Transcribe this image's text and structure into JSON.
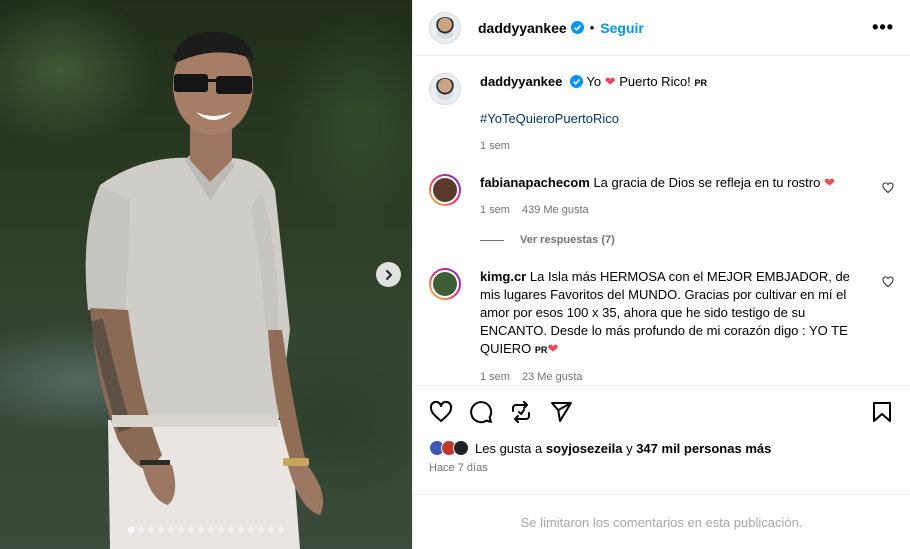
{
  "post": {
    "author": "daddyyankee",
    "follow_label": "Seguir",
    "separator": "•",
    "more_label": "•••",
    "caption_prefix": "Yo",
    "caption_suffix": "Puerto Rico!",
    "caption_badge": "PR",
    "hashtag": "#YoTeQuieroPuertoRico",
    "time": "1 sem"
  },
  "comments": [
    {
      "user": "fabianapachecom",
      "text": "La gracia de Dios se refleja en tu rostro",
      "time": "1 sem",
      "likes": "439 Me gusta",
      "view_replies": "Ver respuestas (7)"
    },
    {
      "user": "kimg.cr",
      "text": "La Isla más HERMOSA con el MEJOR EMBJADOR, de mis lugares Favoritos del MUNDO. Gracias por cultivar en mí el amor por esos 100 x 35, ahora que he sido testigo de su ENCANTO. Desde lo más profundo de mi corazón digo : YO TE QUIERO",
      "badge": "PR",
      "time": "1 sem",
      "likes": "23 Me gusta"
    }
  ],
  "likes": {
    "prefix": "Les gusta a",
    "user": "soyjosezeila",
    "connector": "y",
    "others": "347 mil personas más"
  },
  "date": "Hace 7 días",
  "comments_limited": "Se limitaron los comentarios en esta publicación.",
  "carousel": {
    "total": 16,
    "active": 1
  },
  "colors": {
    "accent": "#0095f6",
    "heart": "#ed4956",
    "verified": "#0095f6"
  },
  "icons": [
    "heart-icon",
    "comment-icon",
    "repost-icon",
    "share-icon",
    "bookmark-icon",
    "chevron-right-icon"
  ]
}
